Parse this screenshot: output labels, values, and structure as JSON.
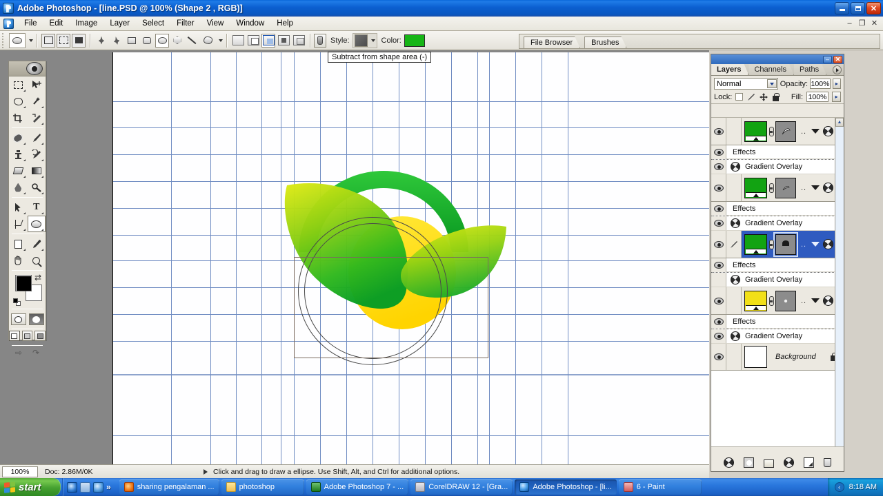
{
  "window": {
    "title": "Adobe Photoshop  - [line.PSD @ 100% (Shape 2 , RGB)]",
    "minimize": "–",
    "restore": "❐",
    "close": "✕",
    "doc_minimize": "–",
    "doc_restore": "❐",
    "doc_close": "✕"
  },
  "menu": {
    "items": [
      "File",
      "Edit",
      "Image",
      "Layer",
      "Select",
      "Filter",
      "View",
      "Window",
      "Help"
    ]
  },
  "options_bar": {
    "tool_name": "ellipse-tool",
    "shape_modes": [
      "shape-layers",
      "paths",
      "fill-pixels"
    ],
    "shape_tools": [
      "pen-tool",
      "freeform-pen-tool",
      "rectangle-tool",
      "rounded-rectangle-tool",
      "ellipse-tool",
      "polygon-tool",
      "line-tool",
      "custom-shape-tool"
    ],
    "combine_modes": [
      "add-to-shape-area",
      "subtract-from-shape-area",
      "intersect-shape-areas",
      "exclude-overlapping-shape-areas"
    ],
    "style_label": "Style:",
    "color_label": "Color:",
    "color_value": "#16b516",
    "style_value": "#555555"
  },
  "tooltip": {
    "text": "Subtract from shape area (-)"
  },
  "palette_well": {
    "tabs": [
      "File Browser",
      "Brushes"
    ]
  },
  "toolbox": {
    "tools": [
      "rectangular-marquee-tool",
      "move-tool",
      "lasso-tool",
      "magic-wand-tool",
      "crop-tool",
      "slice-tool",
      "healing-brush-tool",
      "brush-tool",
      "clone-stamp-tool",
      "history-brush-tool",
      "eraser-tool",
      "gradient-tool",
      "blur-tool",
      "dodge-tool",
      "path-selection-tool",
      "type-tool",
      "pen-tool",
      "ellipse-shape-tool",
      "notes-tool",
      "eyedropper-tool",
      "hand-tool",
      "zoom-tool"
    ],
    "type_glyph": "T",
    "foreground_color": "#000000",
    "background_color": "#ffffff",
    "swap_glyph": "⇄",
    "screen_modes": [
      "standard-screen-mode",
      "full-screen-with-menu-bar",
      "full-screen-mode"
    ],
    "jump_to": "⇨"
  },
  "status_bar": {
    "zoom": "100%",
    "doc_info": "Doc: 2.86M/0K",
    "hint": "Click and drag to draw a ellipse.  Use Shift, Alt, and Ctrl for additional options."
  },
  "layers_panel": {
    "tabs": [
      "Layers",
      "Channels",
      "Paths"
    ],
    "active_tab": "Layers",
    "blend_mode": "Normal",
    "opacity_label": "Opacity:",
    "opacity_value": "100%",
    "lock_label": "Lock:",
    "fill_label": "Fill:",
    "fill_value": "100%",
    "lock_options": [
      "lock-transparent-pixels",
      "lock-image-pixels",
      "lock-position",
      "lock-all"
    ],
    "rows": [
      {
        "name": "",
        "thumb_color": "#12a312",
        "mask_glyph": "pen-shape",
        "selected": false,
        "effects_label": "Effects",
        "effect_name": "Gradient Overlay",
        "effect_visible": true
      },
      {
        "name": "",
        "thumb_color": "#12a312",
        "mask_glyph": "leaf-shape",
        "selected": false,
        "effects_label": "Effects",
        "effect_name": "Gradient Overlay",
        "effect_visible": true
      },
      {
        "name": "",
        "thumb_color": "#12a312",
        "mask_glyph": "circle-shape",
        "selected": true,
        "effects_label": "Effects",
        "effect_name": "Gradient Overlay",
        "effect_visible": false
      },
      {
        "name": "",
        "thumb_color": "#f2e018",
        "mask_glyph": "dot-shape",
        "selected": false,
        "effects_label": "Effects",
        "effect_name": "Gradient Overlay",
        "effect_visible": true
      }
    ],
    "background_row": {
      "name": "Background",
      "locked": true
    },
    "bottom_buttons": [
      "layer-style-button",
      "layer-mask-button",
      "new-group-button",
      "new-fill-adjustment-button",
      "new-layer-button",
      "delete-layer-button"
    ]
  },
  "artwork": {
    "colors": {
      "dark_green_arc": "#0f9f25",
      "leaf_light": "#bfe016",
      "leaf_mid": "#6fc718",
      "leaf_dark": "#0ea52a",
      "yellow": "#ffe01a"
    }
  },
  "taskbar": {
    "start_label": "start",
    "quick_launch": [
      "internet-explorer-icon",
      "show-desktop-icon",
      "windows-media-player-icon"
    ],
    "quick_launch_chevron": "»",
    "tasks": [
      {
        "label": "sharing pengalaman ...",
        "icon": "firefox-icon",
        "active": false
      },
      {
        "label": "photoshop",
        "icon": "folder-icon",
        "active": false
      },
      {
        "label": "Adobe Photoshop 7 - ...",
        "icon": "photoshop7-icon",
        "active": false
      },
      {
        "label": "CorelDRAW 12 - [Gra...",
        "icon": "coreldraw-icon",
        "active": false
      },
      {
        "label": "Adobe Photoshop - [li...",
        "icon": "photoshop-icon",
        "active": true
      },
      {
        "label": "6 - Paint",
        "icon": "paint-icon",
        "active": false
      }
    ],
    "tray_chevron": "‹",
    "clock": "8:18 AM"
  }
}
